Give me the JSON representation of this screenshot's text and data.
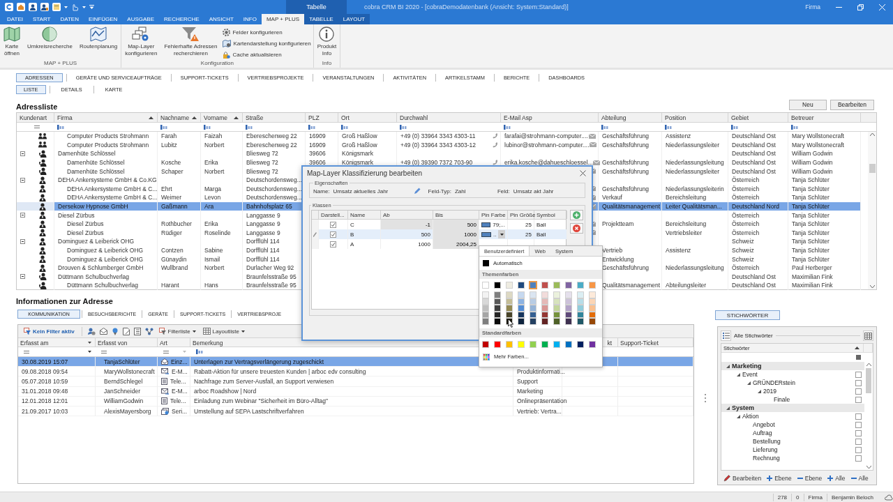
{
  "window": {
    "title": "cobra CRM BI 2020 - [cobraDemodatenbank (Ansicht: System:Standard)]",
    "context_group": "Tabelle",
    "user_label": "Firma"
  },
  "ribbon": {
    "tabs": [
      {
        "label": "DATEI",
        "selected": false,
        "contextual": false
      },
      {
        "label": "START",
        "selected": false,
        "contextual": false
      },
      {
        "label": "DATEN",
        "selected": false,
        "contextual": false
      },
      {
        "label": "EINFÜGEN",
        "selected": false,
        "contextual": false
      },
      {
        "label": "AUSGABE",
        "selected": false,
        "contextual": false
      },
      {
        "label": "RECHERCHE",
        "selected": false,
        "contextual": false
      },
      {
        "label": "ANSICHT",
        "selected": false,
        "contextual": false
      },
      {
        "label": "INFO",
        "selected": false,
        "contextual": false
      },
      {
        "label": "MAP + PLUS",
        "selected": true,
        "contextual": false
      },
      {
        "label": "TABELLE",
        "selected": false,
        "contextual": true
      },
      {
        "label": "LAYOUT",
        "selected": false,
        "contextual": true
      }
    ],
    "groups": [
      {
        "label": "MAP + PLUS",
        "buttons": [
          {
            "label": "Karte\nöffnen",
            "kind": "large"
          },
          {
            "label": "Umkreisrecherche",
            "kind": "large"
          },
          {
            "label": "Routenplanung",
            "kind": "large"
          }
        ]
      },
      {
        "label": "Konfiguration",
        "buttons": [
          {
            "label": "Map-Layer\nkonfigurieren",
            "kind": "large"
          },
          {
            "label": "Fehlerhafte Adressen\nrecherchieren",
            "kind": "large"
          },
          {
            "label": "Felder konfigurieren",
            "kind": "small"
          },
          {
            "label": "Kartendarstellung konfigurieren",
            "kind": "small"
          },
          {
            "label": "Cache aktualisieren",
            "kind": "small"
          }
        ]
      },
      {
        "label": "Info",
        "buttons": [
          {
            "label": "Produkt\nInfo",
            "kind": "large"
          }
        ]
      }
    ]
  },
  "modules": {
    "tabs": [
      {
        "label": "ADRESSEN",
        "selected": true
      },
      {
        "label": "GERÄTE UND SERVICEAUFTRÄGE",
        "selected": false
      },
      {
        "label": "SUPPORT-TICKETS",
        "selected": false
      },
      {
        "label": "VERTRIEBSPROJEKTE",
        "selected": false
      },
      {
        "label": "VERANSTALTUNGEN",
        "selected": false
      },
      {
        "label": "AKTIVITÄTEN",
        "selected": false
      },
      {
        "label": "ARTIKELSTAMM",
        "selected": false
      },
      {
        "label": "BERICHTE",
        "selected": false
      },
      {
        "label": "DASHBOARDS",
        "selected": false
      }
    ],
    "views": [
      {
        "label": "LISTE",
        "selected": true
      },
      {
        "label": "DETAILS",
        "selected": false
      },
      {
        "label": "KARTE",
        "selected": false
      }
    ]
  },
  "address_list": {
    "title": "Adressliste",
    "buttons": [
      "Neu",
      "Bearbeiten"
    ],
    "columns": [
      {
        "label": "Kundenart",
        "sorted": false
      },
      {
        "label": "Firma",
        "sorted": true
      },
      {
        "label": "Nachname",
        "sorted": true
      },
      {
        "label": "Vorname",
        "sorted": true
      },
      {
        "label": "Straße",
        "sorted": false
      },
      {
        "label": "PLZ",
        "sorted": false
      },
      {
        "label": "Ort",
        "sorted": false
      },
      {
        "label": "Durchwahl",
        "sorted": false
      },
      {
        "label": "E-Mail Asp",
        "sorted": false
      },
      {
        "label": "Abteilung",
        "sorted": false
      },
      {
        "label": "Position",
        "sorted": false
      },
      {
        "label": "Gebiet",
        "sorted": false
      },
      {
        "label": "Betreuer",
        "sorted": false
      }
    ],
    "rows": [
      {
        "children": [
          {
            "kind": "pair",
            "firma": "Computer Products Strohmann",
            "nachname": "Farah",
            "vorname": "Faizah",
            "strasse": "Ebereschenweg 22",
            "plz": "16909",
            "ort": "Groß Haßlow",
            "durchwahl": "+49 (0) 33964 3343 4303-11",
            "email": "farafai@strohmann-computer....",
            "abteilung": "Geschäftsführung",
            "position": "Assistenz",
            "gebiet": "Deutschland Ost",
            "betreuer": "Mary Wollstonecraft",
            "phone": true,
            "mail": true,
            "selected": false
          },
          {
            "kind": "pair",
            "firma": "Computer Products Strohmann",
            "nachname": "Lubitz",
            "vorname": "Norbert",
            "strasse": "Ebereschenweg 22",
            "plz": "16909",
            "ort": "Groß Haßlow",
            "durchwahl": "+49 (0) 33964 3343 4303-12",
            "email": "lubinor@strohmann-computer....",
            "abteilung": "Geschäftsführung",
            "position": "Niederlassungsleiter",
            "gebiet": "Deutschland Ost",
            "betreuer": "Mary Wollstonecraft",
            "phone": true,
            "mail": true,
            "selected": false
          }
        ]
      },
      {
        "kind": "call",
        "firma": "Damenhüte Schlössel",
        "strasse": "Bliesweg 72",
        "plz": "39606",
        "ort": "Königsmark",
        "gebiet": "Deutschland Ost",
        "betreuer": "William Godwin",
        "phone": false,
        "mail": false,
        "selected": false,
        "expanded": true,
        "children": [
          {
            "kind": "call",
            "firma": "Damenhüte Schlössel",
            "nachname": "Kosche",
            "vorname": "Erika",
            "strasse": "Bliesweg 72",
            "plz": "39606",
            "ort": "Königsmark",
            "durchwahl": "+49 (0) 39390 7372 703-90",
            "email": "erika.kosche@dahueschloessel...",
            "abteilung": "Geschäftsführung",
            "position": "Niederlassungsleitung",
            "gebiet": "Deutschland Ost",
            "betreuer": "William Godwin",
            "phone": true,
            "mail": true,
            "selected": false
          },
          {
            "kind": "call",
            "firma": "Damenhüte Schlössel",
            "nachname": "Schaper",
            "vorname": "Norbert",
            "strasse": "Bliesweg 72",
            "abteilung": "Geschäftsführung",
            "position": "Niederlassungsleiter",
            "gebiet": "Deutschland Ost",
            "betreuer": "William Godwin",
            "phone": false,
            "mail": true,
            "selected": false
          }
        ]
      },
      {
        "kind": "single",
        "firma": "DEHA Ankersysteme GmbH & Co.KG",
        "strasse": "Deutschordensweg...",
        "gebiet": "Österreich",
        "betreuer": "Tanja Schlüter",
        "phone": false,
        "mail": false,
        "selected": false,
        "expanded": true,
        "children": [
          {
            "kind": "single",
            "firma": "DEHA Ankersysteme GmbH & C...",
            "nachname": "Ehrt",
            "vorname": "Marga",
            "strasse": "Deutschordensweg...",
            "abteilung": "Geschäftsführung",
            "position": "Niederlassungsleiterin",
            "gebiet": "Österreich",
            "betreuer": "Tanja Schlüter",
            "phone": false,
            "mail": true,
            "selected": false
          },
          {
            "kind": "single",
            "firma": "DEHA Ankersysteme GmbH & C...",
            "nachname": "Weimer",
            "vorname": "Levon",
            "strasse": "Deutschordensweg...",
            "abteilung": "Verkauf",
            "position": "Bereichsleitung",
            "gebiet": "Österreich",
            "betreuer": "Tanja Schlüter",
            "phone": false,
            "mail": true,
            "selected": false
          }
        ]
      },
      {
        "kind": "single",
        "firma": "Dersekow Hypnose GmbH",
        "nachname": "Gaßmann",
        "vorname": "Ara",
        "strasse": "Bahnhofsplatz 65",
        "abteilung": "Qualitätsmanagement",
        "position": "Leiter Qualitätsman...",
        "gebiet": "Deutschland Nord",
        "betreuer": "Tanja Schlüter",
        "phone": false,
        "mail": true,
        "selected": true
      },
      {
        "kind": "single",
        "firma": "Diesel Zürbus",
        "strasse": "Langgasse 9",
        "gebiet": "Österreich",
        "betreuer": "Tanja Schlüter",
        "phone": false,
        "mail": false,
        "selected": false,
        "expanded": true,
        "children": [
          {
            "kind": "single",
            "firma": "Diesel Zürbus",
            "nachname": "Rothbucher",
            "vorname": "Erika",
            "strasse": "Langgasse 9",
            "abteilung": "Projektteam",
            "position": "Bereichsleitung",
            "gebiet": "Österreich",
            "betreuer": "Tanja Schlüter",
            "phone": false,
            "mail": true,
            "selected": false
          },
          {
            "kind": "single",
            "firma": "Diesel Zürbus",
            "nachname": "Rüdiger",
            "vorname": "Roselinde",
            "strasse": "Langgasse 9",
            "position": "Vertriebsleiter",
            "gebiet": "Österreich",
            "betreuer": "Tanja Schlüter",
            "phone": false,
            "mail": true,
            "selected": false
          }
        ]
      },
      {
        "kind": "single",
        "firma": "Dominguez & Leiberick OHG",
        "strasse": "Dorfflühl 114",
        "gebiet": "Schweiz",
        "betreuer": "Tanja Schlüter",
        "phone": false,
        "mail": false,
        "selected": false,
        "expanded": true,
        "children": [
          {
            "kind": "single",
            "firma": "Dominguez & Leiberick OHG",
            "nachname": "Contzen",
            "vorname": "Sabine",
            "strasse": "Dorfflühl 114",
            "abteilung": "Vertrieb",
            "position": "Assistenz",
            "gebiet": "Schweiz",
            "betreuer": "Tanja Schlüter",
            "phone": false,
            "mail": false,
            "selected": false
          },
          {
            "kind": "single",
            "firma": "Dominguez & Leiberick OHG",
            "nachname": "Günaydin",
            "vorname": "Ismail",
            "strasse": "Dorfflühl 114",
            "abteilung": "Entwicklung",
            "gebiet": "Schweiz",
            "betreuer": "Tanja Schlüter",
            "phone": false,
            "mail": false,
            "selected": false
          }
        ]
      },
      {
        "kind": "single",
        "firma": "Drouven & Schlumberger GmbH",
        "nachname": "Wullbrand",
        "vorname": "Norbert",
        "strasse": "Durlacher Weg 92",
        "abteilung": "Geschäftsführung",
        "position": "Niederlassungsleitung",
        "gebiet": "Österreich",
        "betreuer": "Paul Herberger",
        "phone": false,
        "mail": false,
        "selected": false
      },
      {
        "kind": "call",
        "firma": "Düttmann Schulbuchverlag",
        "strasse": "Braunfelsstraße 95",
        "gebiet": "Deutschland Ost",
        "betreuer": "Maximilian Fink",
        "phone": false,
        "mail": false,
        "selected": false,
        "expanded": true,
        "children": [
          {
            "kind": "call",
            "firma": "Düttmann Schulbuchverlag",
            "nachname": "Harant",
            "vorname": "Hans",
            "strasse": "Braunfelsstraße 95",
            "abteilung": "Qualitätsmanagement",
            "position": "Abteilungsleiter",
            "gebiet": "Deutschland Ost",
            "betreuer": "Maximilian Fink",
            "phone": false,
            "mail": false,
            "selected": false
          }
        ]
      }
    ]
  },
  "info": {
    "title": "Informationen zur Adresse",
    "tabs": [
      {
        "label": "KOMMUNIKATION",
        "selected": true
      },
      {
        "label": "BESUCHSBERICHTE",
        "selected": false
      },
      {
        "label": "GERÄTE",
        "selected": false
      },
      {
        "label": "SUPPORT-TICKETS",
        "selected": false
      },
      {
        "label": "VERTRIEBSPROJE",
        "selected": false
      }
    ],
    "toolbar": {
      "filter_status": "Kein Filter aktiv",
      "filter_list": "Filterliste",
      "layout_list": "Layoutliste"
    },
    "columns": [
      "Erfasst am",
      "Erfasst von",
      "Art",
      "Bemerkung",
      null,
      "kt",
      "Support-Ticket"
    ],
    "rows": [
      {
        "erfasst_am": "30.08.2019 15:07",
        "erfasst_von": "TanjaSchlüter",
        "kind": "letter",
        "art": "Einz...",
        "bemerkung": "Unterlagen zur Vertragsverlängerung zugeschickt",
        "selected": true
      },
      {
        "erfasst_am": "09.08.2018 09:54",
        "erfasst_von": "MaryWollstonecraft",
        "kind": "email",
        "art": "E-M...",
        "bemerkung": "Rabatt-Aktion für unsere treuesten Kunden | arboc edv consulting",
        "column_5": "Produktinformati...",
        "selected": false
      },
      {
        "erfasst_am": "05.07.2018 10:59",
        "erfasst_von": "BerndSchlegel",
        "kind": "phone",
        "art": "Tele...",
        "bemerkung": "Nachfrage zum Server-Ausfall, an Support verwiesen",
        "column_5": "Support",
        "selected": false
      },
      {
        "erfasst_am": "31.01.2018 09:48",
        "erfasst_von": "JanSchneider",
        "kind": "email",
        "art": "E-M...",
        "bemerkung": "arboc Roadshow | Nord",
        "column_5": "Marketing",
        "selected": false
      },
      {
        "erfasst_am": "12.01.2018 12:01",
        "erfasst_von": "WilliamGodwin",
        "kind": "phone",
        "art": "Tele...",
        "bemerkung": "Einladung zum Webinar \"Sicherheit im Büro-Alltag\"",
        "column_5": "Onlinepräsentation",
        "selected": false
      },
      {
        "erfasst_am": "21.09.2017 10:03",
        "erfasst_von": "AlexisMayersborg",
        "kind": "serial",
        "art": "Seri...",
        "bemerkung": "Umstellung auf SEPA Lastschriftverfahren",
        "column_5": "Vertrieb: Vertra...",
        "selected": false
      }
    ]
  },
  "keywords": {
    "button": "STICHWÖRTER",
    "header": "Alle Stichwörter",
    "column": "Stichwörter",
    "tree": [
      {
        "label": "Marketing",
        "kind": "category",
        "expanded": true,
        "children": [
          {
            "label": "Event",
            "kind": "item",
            "checked": false,
            "expanded": true,
            "children": [
              {
                "label": "GRÜNDERstein",
                "kind": "item",
                "checked": false,
                "expanded": true,
                "children": [
                  {
                    "label": "2019",
                    "kind": "item",
                    "checked": false,
                    "expanded": true,
                    "children": [
                      {
                        "label": "Finale",
                        "kind": "item",
                        "checked": false
                      }
                    ]
                  }
                ]
              }
            ]
          }
        ]
      },
      {
        "label": "System",
        "kind": "category",
        "expanded": true,
        "children": [
          {
            "label": "Aktion",
            "kind": "item",
            "checked": false,
            "expanded": true,
            "children": [
              {
                "label": "Angebot",
                "kind": "item",
                "checked": false
              },
              {
                "label": "Auftrag",
                "kind": "item",
                "checked": false
              },
              {
                "label": "Bestellung",
                "kind": "item",
                "checked": false
              },
              {
                "label": "Lieferung",
                "kind": "item",
                "checked": false
              },
              {
                "label": "Rechnung",
                "kind": "item",
                "checked": false
              }
            ]
          }
        ]
      }
    ],
    "actions": [
      {
        "label": "Bearbeiten",
        "kind": "edit"
      },
      {
        "label": "Ebene",
        "kind": "add"
      },
      {
        "label": "Ebene",
        "kind": "remove"
      },
      {
        "label": "Alle",
        "kind": "add"
      },
      {
        "label": "Alle",
        "kind": "remove"
      }
    ]
  },
  "status_bar": {
    "items": [
      "278",
      "0",
      "Firma",
      "Benjamin Beloch"
    ]
  },
  "dialog": {
    "title": "Map-Layer Klassifizierung bearbeiten",
    "properties": {
      "legend": "Eigenschaften",
      "name_label": "Name:",
      "name": "Umsatz aktuelles Jahr",
      "type_label": "Feld-Typ:",
      "type": "Zahl",
      "field_label": "Feld:",
      "field": "Umsatz akt Jahr"
    },
    "classes": {
      "legend": "Klassen",
      "columns": [
        "Darstell...",
        "Name",
        "Ab",
        "Bis",
        "Pin Farbe",
        "Pin Größe",
        "Symbol"
      ],
      "rows": [
        {
          "shown": true,
          "name": "C",
          "ab": "-1",
          "ab_locked": true,
          "bis": "500",
          "color": "#4f81bd",
          "pin_text": "79;...",
          "pin_size": "25",
          "symbol": "Ball",
          "selected": false
        },
        {
          "shown": true,
          "name": "B",
          "ab": "500",
          "ab_locked": false,
          "bis": "1000",
          "color": "#4f81bd",
          "pin_text": "..",
          "pin_size": "25",
          "symbol": "Ball",
          "selected": true
        },
        {
          "shown": true,
          "name": "A",
          "ab": "1000",
          "ab_locked": false,
          "bis": "2004,25",
          "selected": false
        }
      ]
    }
  },
  "color_picker": {
    "tabs": [
      {
        "label": "Benutzerdefiniert",
        "selected": true
      },
      {
        "label": "Web",
        "selected": false
      },
      {
        "label": "System",
        "selected": false
      }
    ],
    "automatic": {
      "label": "Automatisch",
      "color": "#000000"
    },
    "theme_heading": "Themenfarben",
    "theme": [
      {
        "color": "#ffffff",
        "selected": false,
        "shades": [
          {
            "color": "#f2f2f2",
            "selected": false
          },
          {
            "color": "#d8d8d8",
            "selected": false
          },
          {
            "color": "#bfbfbf",
            "selected": false
          },
          {
            "color": "#a5a5a5",
            "selected": false
          },
          {
            "color": "#7f7f7f",
            "selected": false
          }
        ]
      },
      {
        "color": "#000000",
        "selected": false,
        "shades": [
          {
            "color": "#7f7f7f",
            "selected": false
          },
          {
            "color": "#595959",
            "selected": false
          },
          {
            "color": "#3f3f3f",
            "selected": false
          },
          {
            "color": "#262626",
            "selected": false
          },
          {
            "color": "#0c0c0c",
            "selected": false
          }
        ]
      },
      {
        "color": "#eeece1",
        "selected": false,
        "shades": [
          {
            "color": "#ddd9c3",
            "selected": false
          },
          {
            "color": "#c4bd97",
            "selected": false
          },
          {
            "color": "#938953",
            "selected": false
          },
          {
            "color": "#494429",
            "selected": false
          },
          {
            "color": "#1d1b10",
            "selected": false
          }
        ]
      },
      {
        "color": "#1f497d",
        "selected": false,
        "shades": [
          {
            "color": "#c6d9f0",
            "selected": false
          },
          {
            "color": "#8db3e2",
            "selected": false
          },
          {
            "color": "#548dd4",
            "selected": false
          },
          {
            "color": "#17365d",
            "selected": false
          },
          {
            "color": "#0f243e",
            "selected": false
          }
        ]
      },
      {
        "color": "#4f81bd",
        "selected": true,
        "shades": [
          {
            "color": "#dbe5f1",
            "selected": false
          },
          {
            "color": "#b8cce4",
            "selected": false
          },
          {
            "color": "#95b3d7",
            "selected": false
          },
          {
            "color": "#366092",
            "selected": false
          },
          {
            "color": "#244061",
            "selected": false
          }
        ]
      },
      {
        "color": "#c0504d",
        "selected": false,
        "shades": [
          {
            "color": "#f2dcdb",
            "selected": false
          },
          {
            "color": "#e5b9b7",
            "selected": false
          },
          {
            "color": "#d99694",
            "selected": false
          },
          {
            "color": "#953734",
            "selected": false
          },
          {
            "color": "#632423",
            "selected": false
          }
        ]
      },
      {
        "color": "#9bbb59",
        "selected": false,
        "shades": [
          {
            "color": "#ebf1dd",
            "selected": false
          },
          {
            "color": "#d7e3bc",
            "selected": false
          },
          {
            "color": "#c3d69b",
            "selected": false
          },
          {
            "color": "#76923c",
            "selected": false
          },
          {
            "color": "#4f6128",
            "selected": false
          }
        ]
      },
      {
        "color": "#8064a2",
        "selected": false,
        "shades": [
          {
            "color": "#e5e0ec",
            "selected": false
          },
          {
            "color": "#ccc1d9",
            "selected": false
          },
          {
            "color": "#b2a2c7",
            "selected": false
          },
          {
            "color": "#5f497a",
            "selected": false
          },
          {
            "color": "#3f3151",
            "selected": false
          }
        ]
      },
      {
        "color": "#4bacc6",
        "selected": false,
        "shades": [
          {
            "color": "#dbeef3",
            "selected": false
          },
          {
            "color": "#b7dde8",
            "selected": false
          },
          {
            "color": "#92cddc",
            "selected": false
          },
          {
            "color": "#31859b",
            "selected": false
          },
          {
            "color": "#205867",
            "selected": false
          }
        ]
      },
      {
        "color": "#f79646",
        "selected": false,
        "shades": [
          {
            "color": "#fdeada",
            "selected": false
          },
          {
            "color": "#fbd5b5",
            "selected": false
          },
          {
            "color": "#fac08f",
            "selected": false
          },
          {
            "color": "#e36c09",
            "selected": false
          },
          {
            "color": "#974806",
            "selected": false
          }
        ]
      }
    ],
    "standard_heading": "Standardfarben",
    "standard": [
      {
        "color": "#c00000",
        "selected": false
      },
      {
        "color": "#ff0000",
        "selected": false
      },
      {
        "color": "#ffc000",
        "selected": false
      },
      {
        "color": "#ffff00",
        "selected": false
      },
      {
        "color": "#92d050",
        "selected": false
      },
      {
        "color": "#00b050",
        "selected": false
      },
      {
        "color": "#00b0f0",
        "selected": false
      },
      {
        "color": "#0070c0",
        "selected": false
      },
      {
        "color": "#002060",
        "selected": false
      },
      {
        "color": "#7030a0",
        "selected": false
      }
    ],
    "more": "Mehr Farben..."
  }
}
